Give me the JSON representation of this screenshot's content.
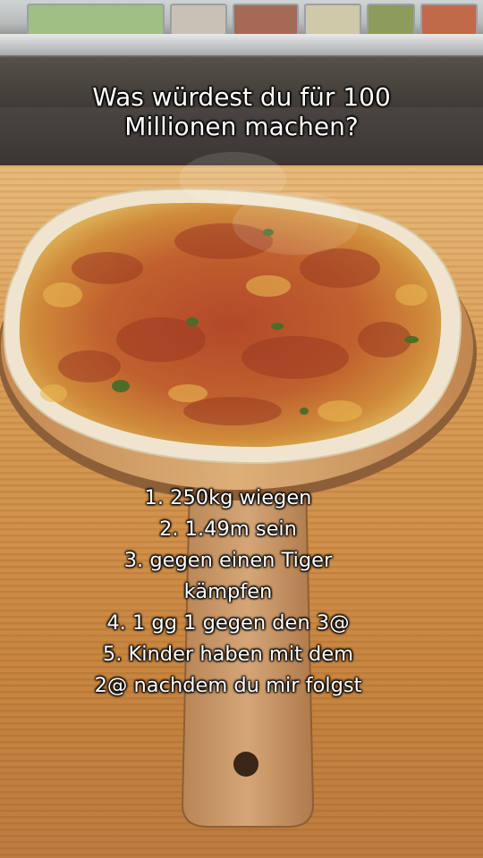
{
  "overlay": {
    "headline_lines": [
      "Was würdest du für 100",
      "Millionen machen?"
    ],
    "list_lines": [
      "1. 250kg wiegen",
      "2. 1.49m sein",
      "3. gegen einen Tiger",
      "kämpfen",
      "4. 1 gg 1 gegen den 3@",
      "5. Kinder haben mit dem",
      "2@ nachdem du mir folgst"
    ]
  },
  "colors": {
    "caption_text": "#ffffff",
    "caption_outline": "#000000",
    "sauce": "#b8522a",
    "crust": "#f2ead6",
    "board": "#d6a367",
    "counter": "#d79b55"
  }
}
